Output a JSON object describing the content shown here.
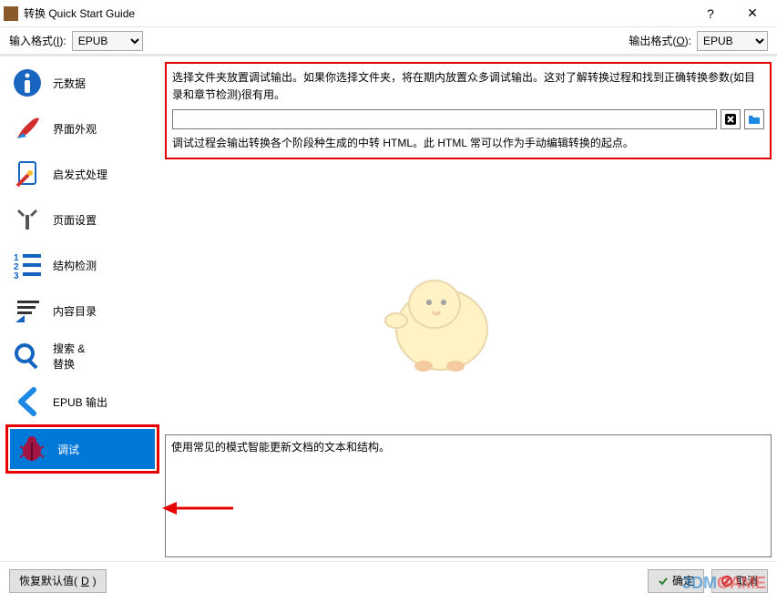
{
  "titlebar": {
    "title": "转换 Quick Start Guide",
    "help": "?",
    "close": "✕"
  },
  "format": {
    "input_label_pre": "输入格式(",
    "input_label_key": "I",
    "input_label_post": "):",
    "input_value": "EPUB",
    "output_label_pre": "输出格式(",
    "output_label_key": "O",
    "output_label_post": "):",
    "output_value": "EPUB"
  },
  "sidebar": {
    "items": [
      {
        "label": "元数据"
      },
      {
        "label": "界面外观"
      },
      {
        "label": "启发式处理"
      },
      {
        "label": "页面设置"
      },
      {
        "label": "结构检测"
      },
      {
        "label": "内容目录"
      },
      {
        "label": "搜索 &\n替换"
      },
      {
        "label": "EPUB 输出"
      },
      {
        "label": "调试"
      }
    ]
  },
  "panel": {
    "desc": "选择文件夹放置调试输出。如果你选择文件夹，将在期内放置众多调试输出。这对了解转换过程和找到正确转换参数(如目录和章节检测)很有用。",
    "path_value": "",
    "note": "调试过程会输出转换各个阶段种生成的中转 HTML。此 HTML 常可以作为手动编辑转换的起点。"
  },
  "info": {
    "text": "使用常见的模式智能更新文档的文本和结构。"
  },
  "footer": {
    "restore_pre": "恢复默认值(",
    "restore_key": "D",
    "restore_post": ")",
    "ok": "确定",
    "cancel": "取消"
  },
  "watermark": {
    "a": "3DM",
    "b": "GAME"
  }
}
